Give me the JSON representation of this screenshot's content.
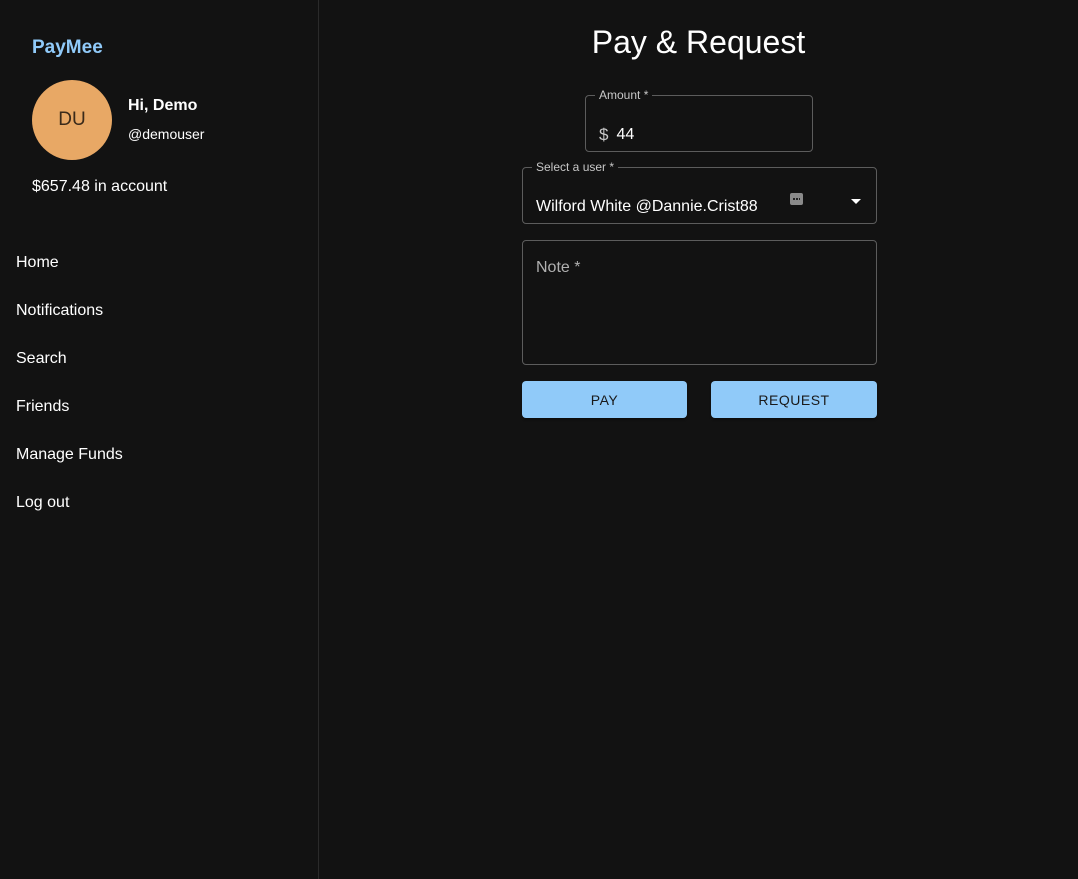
{
  "sidebar": {
    "brand": "PayMee",
    "avatar_initials": "DU",
    "avatar_color": "#e8a865",
    "greeting": "Hi, Demo",
    "username": "@demouser",
    "balance": "$657.48 in account",
    "nav": [
      {
        "label": "Home"
      },
      {
        "label": "Notifications"
      },
      {
        "label": "Search"
      },
      {
        "label": "Friends"
      },
      {
        "label": "Manage Funds"
      },
      {
        "label": "Log out"
      }
    ]
  },
  "main": {
    "title": "Pay & Request",
    "amount": {
      "label": "Amount *",
      "currency_symbol": "$",
      "value": "44"
    },
    "user_select": {
      "label": "Select a user *",
      "selected": "Wilford White @Dannie.Crist88",
      "icon": "keyboard-icon"
    },
    "note": {
      "label": "Note *"
    },
    "buttons": {
      "pay": "PAY",
      "request": "REQUEST"
    }
  },
  "colors": {
    "background": "#121212",
    "accent": "#90caf9",
    "border": "#5c5c5c"
  }
}
